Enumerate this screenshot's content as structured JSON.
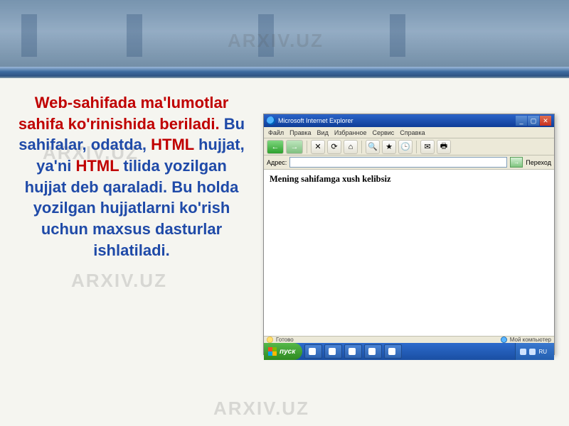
{
  "watermark": "ARXIV.UZ",
  "slide": {
    "part1_red": "Web-sahifada ma'lumotlar sahifa ko'rinishida beriladi.",
    "part2a_blue": "Bu sahifalar, odatda,",
    "part2b_red": "HTML",
    "part2c_blue": "hujjat, ya'ni",
    "part2d_red": "HTML",
    "part2e_blue": "tilida yozilgan hujjat deb qaraladi. Bu holda yozilgan hujjatlarni ko'rish uchun maxsus dasturlar ishlatiladi."
  },
  "browser": {
    "title": "Microsoft Internet Explorer",
    "menu": [
      "Файл",
      "Правка",
      "Вид",
      "Избранное",
      "Сервис",
      "Справка"
    ],
    "toolbar": {
      "back": "←",
      "forward": "→",
      "stop": "✕",
      "refresh": "⟳",
      "home": "⌂",
      "search": "🔍",
      "favorites": "★",
      "history": "🕒",
      "mail": "✉",
      "print": "🖶"
    },
    "address_label": "Адрес:",
    "address_value": "",
    "go_label": "→",
    "links_label": "Переход",
    "page_text": "Mening sahifamga xush kelibsiz",
    "status_done": "Готово",
    "status_zone": "Мой компьютер"
  },
  "taskbar": {
    "start": "пуск",
    "items": [
      "",
      "",
      "",
      "",
      ""
    ],
    "lang": "RU",
    "clock": ""
  }
}
